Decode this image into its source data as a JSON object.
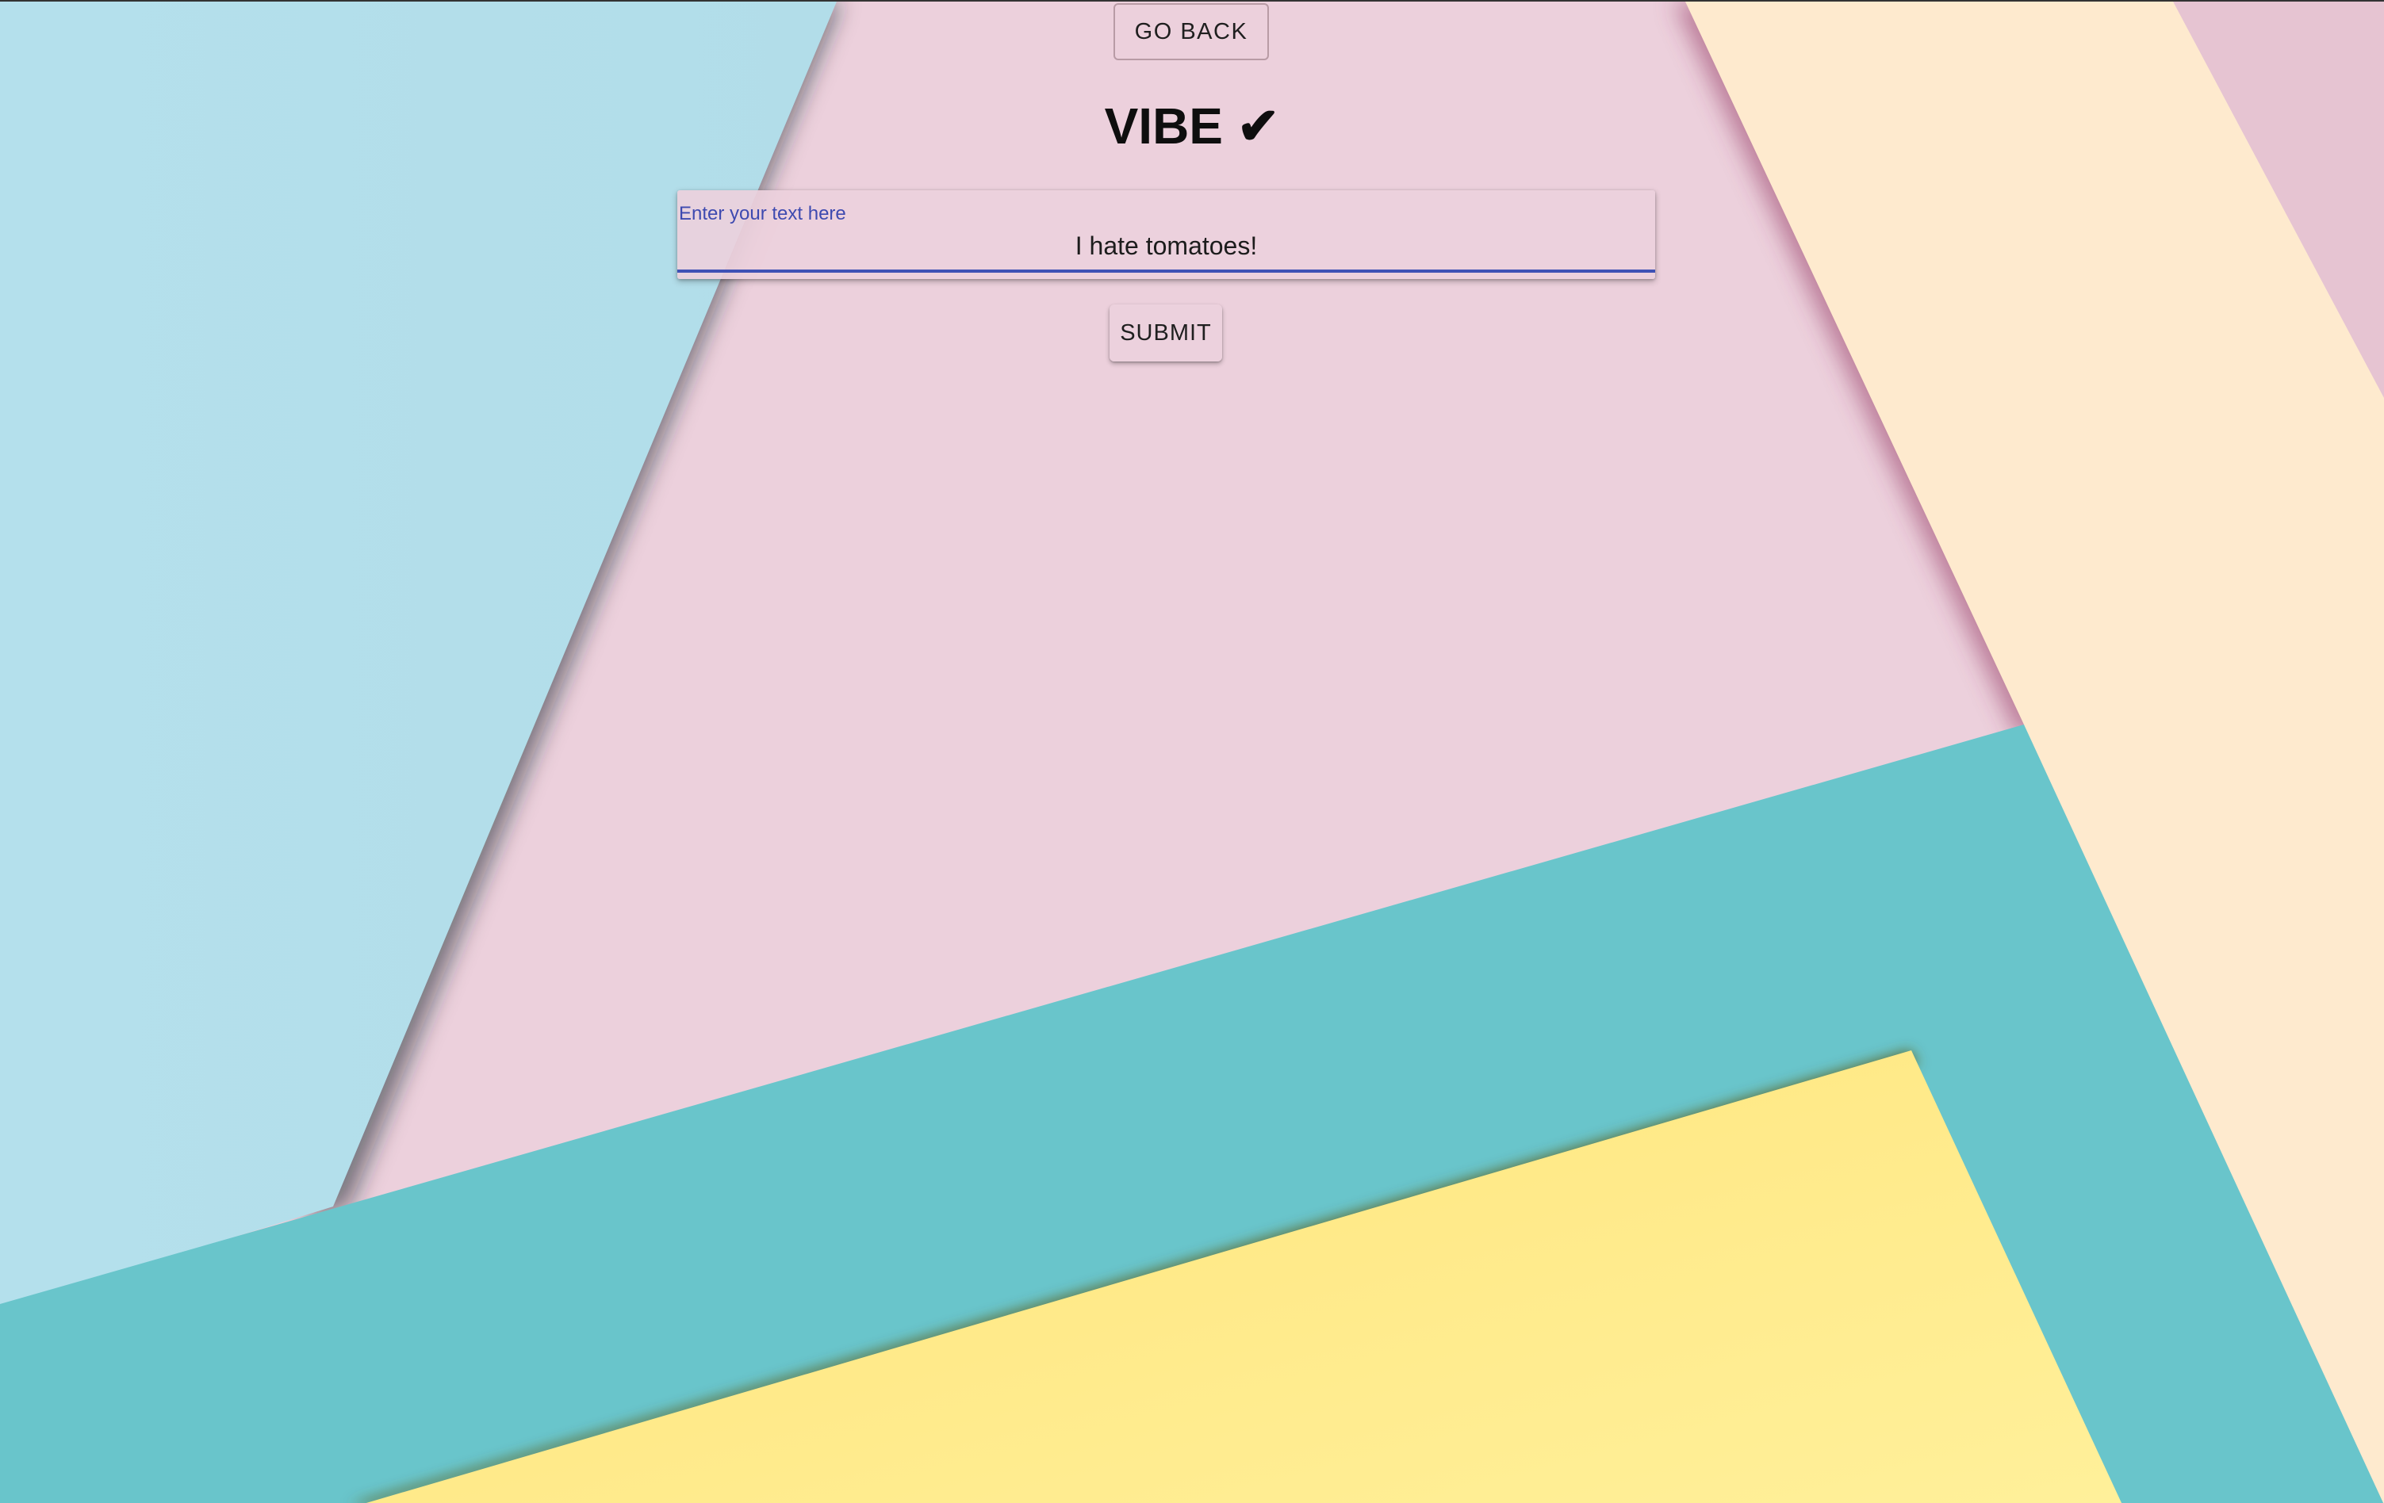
{
  "nav": {
    "go_back_label": "GO BACK"
  },
  "header": {
    "title": "VIBE ✔"
  },
  "form": {
    "input_label": "Enter your text here",
    "input_value": "I hate tomatoes!",
    "submit_label": "SUBMIT"
  },
  "colors": {
    "background_pink": "#ecd0dc",
    "light_blue": "#b4e0ec",
    "teal": "#69c5cb",
    "cream": "#feeace",
    "mauve": "#e6c4d2",
    "yellow": "#ffe984",
    "accent_blue": "#3f51b5"
  }
}
